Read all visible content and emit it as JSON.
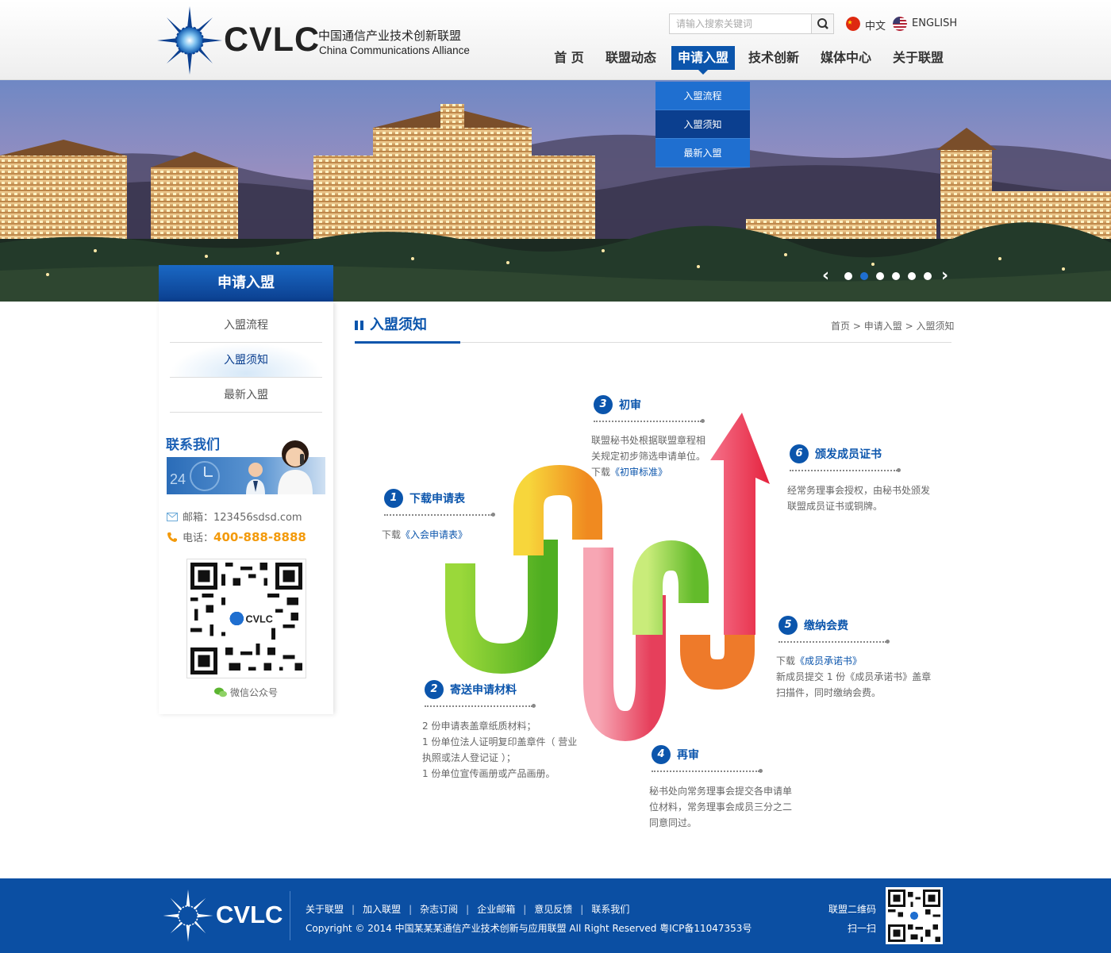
{
  "brand": {
    "logo_text": "CVLC",
    "name_cn": "中国通信产业技术创新联盟",
    "name_en": "China Communications Alliance"
  },
  "search": {
    "placeholder": "请输入搜索关键词"
  },
  "languages": [
    {
      "label": "中文",
      "icon": "china-flag-icon"
    },
    {
      "label": "ENGLISH",
      "icon": "usa-flag-icon"
    }
  ],
  "nav": {
    "items": [
      {
        "label": "首 页"
      },
      {
        "label": "联盟动态"
      },
      {
        "label": "申请入盟",
        "active": true
      },
      {
        "label": "技术创新"
      },
      {
        "label": "媒体中心"
      },
      {
        "label": "关于联盟"
      }
    ],
    "dropdown": [
      {
        "label": "入盟流程"
      },
      {
        "label": "入盟须知",
        "active": true
      },
      {
        "label": "最新入盟"
      }
    ]
  },
  "banner": {
    "slide_count": 6,
    "active_slide": 2
  },
  "sidebar": {
    "title": "申请入盟",
    "items": [
      {
        "label": "入盟流程"
      },
      {
        "label": "入盟须知",
        "active": true
      },
      {
        "label": "最新入盟"
      }
    ],
    "contact": {
      "title": "联系我们",
      "email_label": "邮箱：",
      "email": "123456sdsd.com",
      "phone_label": "电话：",
      "phone": "400-888-8888",
      "qr_logo_text": "CVLC",
      "wechat_label": "微信公众号"
    }
  },
  "content": {
    "title": "入盟须知",
    "breadcrumb": [
      "首页",
      ">",
      "申请入盟",
      ">",
      "入盟须知"
    ],
    "steps": [
      {
        "num": "1",
        "title": "下载申请表",
        "lines": [
          {
            "prefix": "下载",
            "link": "《入会申请表》"
          }
        ]
      },
      {
        "num": "2",
        "title": "寄送申请材料",
        "lines": [
          {
            "text": "2 份申请表盖章纸质材料；"
          },
          {
            "text": "1 份单位法人证明复印盖章件（ 营业"
          },
          {
            "text": "执照或法人登记证 ）；"
          },
          {
            "text": "1 份单位宣传画册或产品画册。"
          }
        ]
      },
      {
        "num": "3",
        "title": "初审",
        "lines": [
          {
            "text": "联盟秘书处根据联盟章程相"
          },
          {
            "text": "关规定初步筛选申请单位。"
          },
          {
            "prefix": "下载",
            "link": "《初审标准》"
          }
        ]
      },
      {
        "num": "4",
        "title": "再审",
        "lines": [
          {
            "text": "秘书处向常务理事会提交各申请单"
          },
          {
            "text": "位材料，常务理事会成员三分之二"
          },
          {
            "text": "同意同过。"
          }
        ]
      },
      {
        "num": "5",
        "title": "缴纳会费",
        "lines": [
          {
            "prefix": "下载",
            "link": "《成员承诺书》"
          },
          {
            "text": "新成员提交 1 份《成员承诺书》盖章"
          },
          {
            "text": "扫描件，同时缴纳会费。"
          }
        ]
      },
      {
        "num": "6",
        "title": "颁发成员证书",
        "lines": [
          {
            "text": "经常务理事会授权，由秘书处颁发"
          },
          {
            "text": "联盟成员证书或铜牌。"
          }
        ]
      }
    ]
  },
  "footer": {
    "logo_text": "CVLC",
    "links": [
      "关于联盟",
      "加入联盟",
      "杂志订阅",
      "企业邮箱",
      "意见反馈",
      "联系我们"
    ],
    "copyright": "Copyright © 2014 中国某某某通信产业技术创新与应用联盟 All Right Reserved    粤ICP备11047353号",
    "qr_label": "联盟二维码",
    "qr_sub": "扫一扫"
  }
}
